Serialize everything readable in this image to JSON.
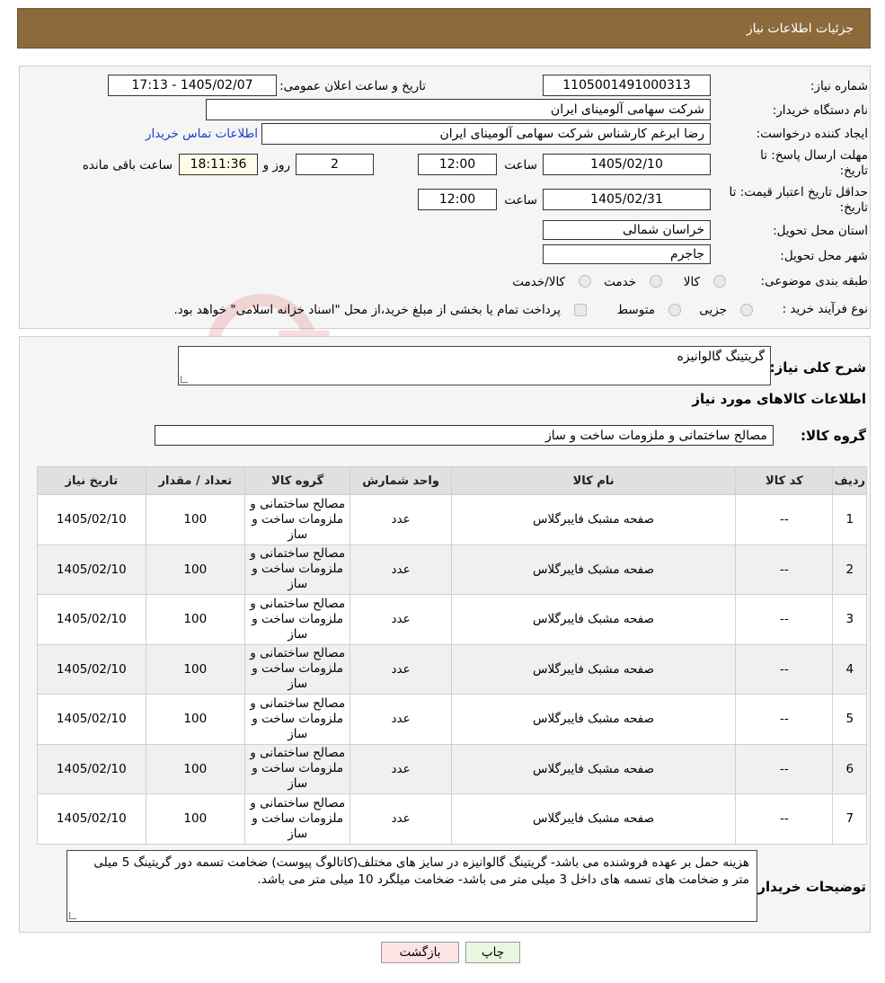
{
  "header": {
    "title": "جزئیات اطلاعات نیاز"
  },
  "watermark": {
    "text": "AriaTender.neT"
  },
  "info": {
    "need_number_label": "شماره نیاز:",
    "need_number": "1105001491000313",
    "announce_label": "تاریخ و ساعت اعلان عمومی:",
    "announce_value": "1405/02/07 - 17:13",
    "buyer_org_label": "نام دستگاه خریدار:",
    "buyer_org": "شرکت سهامی آلومینای ایران",
    "requester_label": "ایجاد کننده درخواست:",
    "requester": "رضا ابرغم کارشناس شرکت سهامی آلومینای ایران",
    "buyer_contact_link": "اطلاعات تماس خریدار",
    "deadline_label_1": "مهلت ارسال پاسخ: تا",
    "deadline_label_2": "تاریخ:",
    "deadline_date": "1405/02/10",
    "time_label": "ساعت",
    "deadline_time": "12:00",
    "days_value": "2",
    "days_label": "روز و",
    "remaining_time": "18:11:36",
    "remaining_label": "ساعت باقی مانده",
    "price_validity_label_1": "حداقل تاریخ اعتبار قیمت: تا",
    "price_validity_label_2": "تاریخ:",
    "price_validity_date": "1405/02/31",
    "price_validity_time": "12:00",
    "province_label": "استان محل تحویل:",
    "province": "خراسان شمالی",
    "city_label": "شهر محل تحویل:",
    "city": "جاجرم",
    "category_label": "طبقه بندی موضوعی:",
    "category_options": [
      "کالا",
      "خدمت",
      "کالا/خدمت"
    ],
    "process_label": "نوع فرآیند خرید :",
    "process_options": [
      "جزیی",
      "متوسط"
    ],
    "payment_note": "پرداخت تمام یا بخشی از مبلغ خرید،از محل \"اسناد خزانه اسلامی\" خواهد بود."
  },
  "details": {
    "summary_label": "شرح کلی نیاز:",
    "summary": "گریتینگ گالوانیزه",
    "goods_info_title": "اطلاعات کالاهای مورد نیاز",
    "goods_group_label": "گروه کالا:",
    "goods_group": "مصالح ساختمانی و ملزومات ساخت و ساز",
    "table": {
      "headers": [
        "ردیف",
        "کد کالا",
        "نام کالا",
        "واحد شمارش",
        "گروه کالا",
        "تعداد / مقدار",
        "تاریخ نیاز"
      ],
      "rows": [
        [
          "1",
          "--",
          "صفحه مشبک فایبرگلاس",
          "عدد",
          "مصالح ساختمانی و ملزومات ساخت و ساز",
          "100",
          "1405/02/10"
        ],
        [
          "2",
          "--",
          "صفحه مشبک فایبرگلاس",
          "عدد",
          "مصالح ساختمانی و ملزومات ساخت و ساز",
          "100",
          "1405/02/10"
        ],
        [
          "3",
          "--",
          "صفحه مشبک فایبرگلاس",
          "عدد",
          "مصالح ساختمانی و ملزومات ساخت و ساز",
          "100",
          "1405/02/10"
        ],
        [
          "4",
          "--",
          "صفحه مشبک فایبرگلاس",
          "عدد",
          "مصالح ساختمانی و ملزومات ساخت و ساز",
          "100",
          "1405/02/10"
        ],
        [
          "5",
          "--",
          "صفحه مشبک فایبرگلاس",
          "عدد",
          "مصالح ساختمانی و ملزومات ساخت و ساز",
          "100",
          "1405/02/10"
        ],
        [
          "6",
          "--",
          "صفحه مشبک فایبرگلاس",
          "عدد",
          "مصالح ساختمانی و ملزومات ساخت و ساز",
          "100",
          "1405/02/10"
        ],
        [
          "7",
          "--",
          "صفحه مشبک فایبرگلاس",
          "عدد",
          "مصالح ساختمانی و ملزومات ساخت و ساز",
          "100",
          "1405/02/10"
        ]
      ]
    },
    "buyer_notes_label": "توضیحات خریدار:",
    "buyer_notes": "هزینه حمل بر عهده فروشنده می باشد- گریتینگ گالوانیزه در سایز های مختلف(کاتالوگ پیوست) ضخامت تسمه دور گریتینگ 5 میلی متر و ضخامت های تسمه های داخل 3 میلی متر می باشد- ضخامت میلگرد 10 میلی متر می باشد."
  },
  "buttons": {
    "print": "چاپ",
    "back": "بازگشت"
  },
  "colors": {
    "header_bg": "#8c6a3c",
    "link": "#1a3fc8",
    "back_button_bg": "#fde3e3",
    "print_button_bg": "#e9f7e0"
  }
}
